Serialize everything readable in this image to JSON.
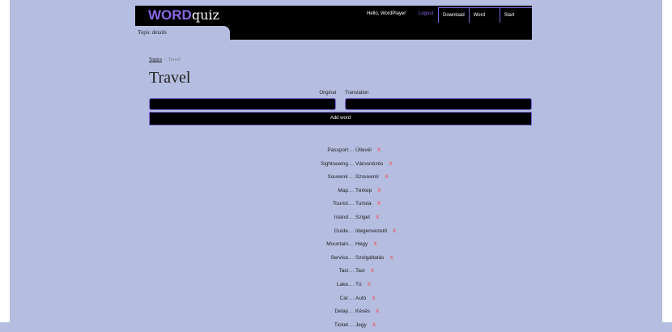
{
  "header": {
    "logo_word": "WORD",
    "logo_quiz": "quiz",
    "greeting": "Hello, WordPlayer",
    "logout": "Logout",
    "nav": [
      "Download",
      "Word editor",
      "Start playing"
    ]
  },
  "tab": {
    "label": "Topic details"
  },
  "breadcrumb": {
    "root": "Topics",
    "separator": "/",
    "current": "Travel"
  },
  "page": {
    "title": "Travel"
  },
  "form": {
    "original_label": "Original",
    "translation_label": "Translation",
    "original_value": "",
    "translation_value": "",
    "add_button": "Add word"
  },
  "words": [
    {
      "original": "Passport",
      "translation": "Útlevél"
    },
    {
      "original": "Sightseeing",
      "translation": "Városnézés"
    },
    {
      "original": "Souvenir",
      "translation": "Szouvenír"
    },
    {
      "original": "Map",
      "translation": "Térkép"
    },
    {
      "original": "Tourist",
      "translation": "Turista"
    },
    {
      "original": "Island",
      "translation": "Sziget"
    },
    {
      "original": "Guide",
      "translation": "Idegenvezető"
    },
    {
      "original": "Mountain",
      "translation": "Hegy"
    },
    {
      "original": "Service",
      "translation": "Szolgáltatás"
    },
    {
      "original": "Taxi",
      "translation": "Taxi"
    },
    {
      "original": "Lake",
      "translation": "Tó"
    },
    {
      "original": "Car",
      "translation": "Autó"
    },
    {
      "original": "Delay",
      "translation": "Késés"
    },
    {
      "original": "Ticket",
      "translation": "Jegy"
    }
  ],
  "delete_symbol": "X",
  "colors": {
    "accent": "#8b67e6",
    "delete": "#ff3b3b",
    "background": "#b5bde0"
  }
}
